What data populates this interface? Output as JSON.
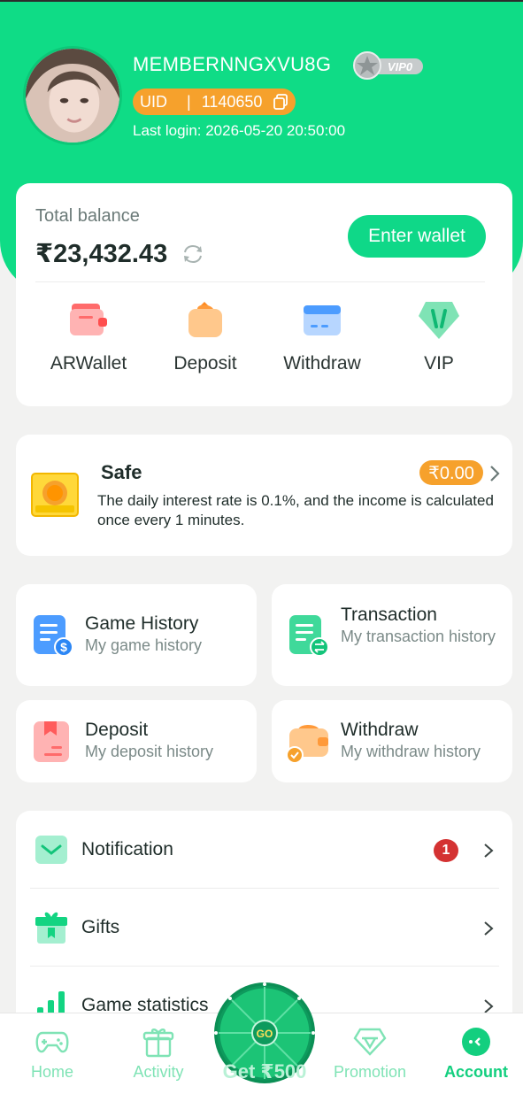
{
  "profile": {
    "username": "MEMBERNNGXVU8G",
    "vip_level": "VIP0",
    "uid_label": "UID",
    "uid_separator": "|",
    "uid_value": "1140650",
    "last_login": "Last login: 2026-05-20 20:50:00"
  },
  "balance": {
    "label": "Total balance",
    "amount": "₹23,432.43",
    "enter_wallet": "Enter wallet",
    "actions": [
      {
        "label": "ARWallet",
        "icon": "wallet-icon"
      },
      {
        "label": "Deposit",
        "icon": "deposit-icon"
      },
      {
        "label": "Withdraw",
        "icon": "withdraw-icon"
      },
      {
        "label": "VIP",
        "icon": "vip-icon"
      }
    ]
  },
  "safe": {
    "title": "Safe",
    "amount": "₹0.00",
    "description": "The daily interest rate is 0.1%, and the income is calculated once every 1 minutes."
  },
  "history": [
    {
      "title": "Game History",
      "subtitle": "My game history",
      "icon": "game-history-icon"
    },
    {
      "title": "Transaction",
      "subtitle": "My transaction history",
      "icon": "transaction-icon"
    },
    {
      "title": "Deposit",
      "subtitle": "My deposit history",
      "icon": "deposit-history-icon"
    },
    {
      "title": "Withdraw",
      "subtitle": "My withdraw history",
      "icon": "withdraw-history-icon"
    }
  ],
  "menu": [
    {
      "label": "Notification",
      "badge": "1",
      "icon": "notification-icon"
    },
    {
      "label": "Gifts",
      "icon": "gift-icon"
    },
    {
      "label": "Game statistics",
      "icon": "stats-icon"
    }
  ],
  "bottom_nav": {
    "items": [
      {
        "label": "Home",
        "icon": "gamepad-icon"
      },
      {
        "label": "Activity",
        "icon": "gift-box-icon"
      },
      {
        "label": "Promotion",
        "icon": "diamond-icon"
      },
      {
        "label": "Account",
        "icon": "account-icon"
      }
    ],
    "wheel_label": "Get ₹500",
    "wheel_button": "GO",
    "active": "Account"
  },
  "colors": {
    "brand_green": "#0fdc86",
    "accent_orange": "#f6a12c",
    "badge_red": "#d43232"
  }
}
